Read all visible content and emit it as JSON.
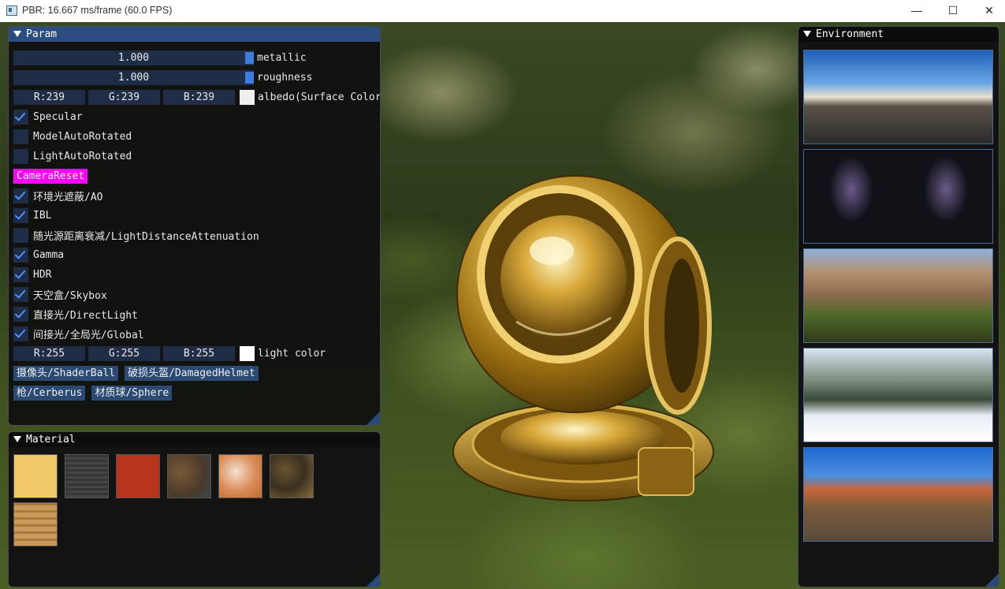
{
  "window": {
    "title": "PBR: 16.667 ms/frame (60.0 FPS)",
    "minimize": "—",
    "maximize": "☐",
    "close": "✕"
  },
  "param": {
    "title": "Param",
    "metallic": {
      "value": "1.000",
      "label": "metallic",
      "fraction": 1.0
    },
    "roughness": {
      "value": "1.000",
      "label": "roughness",
      "fraction": 1.0
    },
    "albedo": {
      "r": "R:239",
      "g": "G:239",
      "b": "B:239",
      "swatch": "#efefef",
      "label": "albedo(Surface Color"
    },
    "checks": [
      {
        "label": "Specular",
        "checked": true
      },
      {
        "label": "ModelAutoRotated",
        "checked": false
      },
      {
        "label": "LightAutoRotated",
        "checked": false
      }
    ],
    "camera_reset": "CameraReset",
    "checks2": [
      {
        "label": "环境光遮蔽/AO",
        "checked": true
      },
      {
        "label": "IBL",
        "checked": true
      },
      {
        "label": "随光源距离衰减/LightDistanceAttenuation",
        "checked": false
      },
      {
        "label": "Gamma",
        "checked": true
      },
      {
        "label": "HDR",
        "checked": true
      },
      {
        "label": "天空盒/Skybox",
        "checked": true
      },
      {
        "label": "直接光/DirectLight",
        "checked": true
      },
      {
        "label": "间接光/全局光/Global",
        "checked": true
      }
    ],
    "light": {
      "r": "R:255",
      "g": "G:255",
      "b": "B:255",
      "swatch": "#ffffff",
      "label": "light color"
    },
    "models": [
      "摄像头/ShaderBall",
      "破损头盔/DamagedHelmet",
      "枪/Cerberus",
      "材质球/Sphere"
    ]
  },
  "material": {
    "title": "Material",
    "swatches": [
      "gold",
      "metal-grid",
      "rust-red",
      "rusted-iron",
      "cracked-paint",
      "camo-rust",
      "wood"
    ]
  },
  "environment": {
    "title": "Environment",
    "maps": [
      "city-sunset",
      "milky-way",
      "ruins",
      "snow-forest",
      "red-canyon"
    ]
  },
  "colors": {
    "accent": "#3d7de0",
    "header": "#2c4d7f",
    "frame_bg": "#1f2d47",
    "button": "#2a4a74",
    "camera_reset": "#ff00ff"
  }
}
